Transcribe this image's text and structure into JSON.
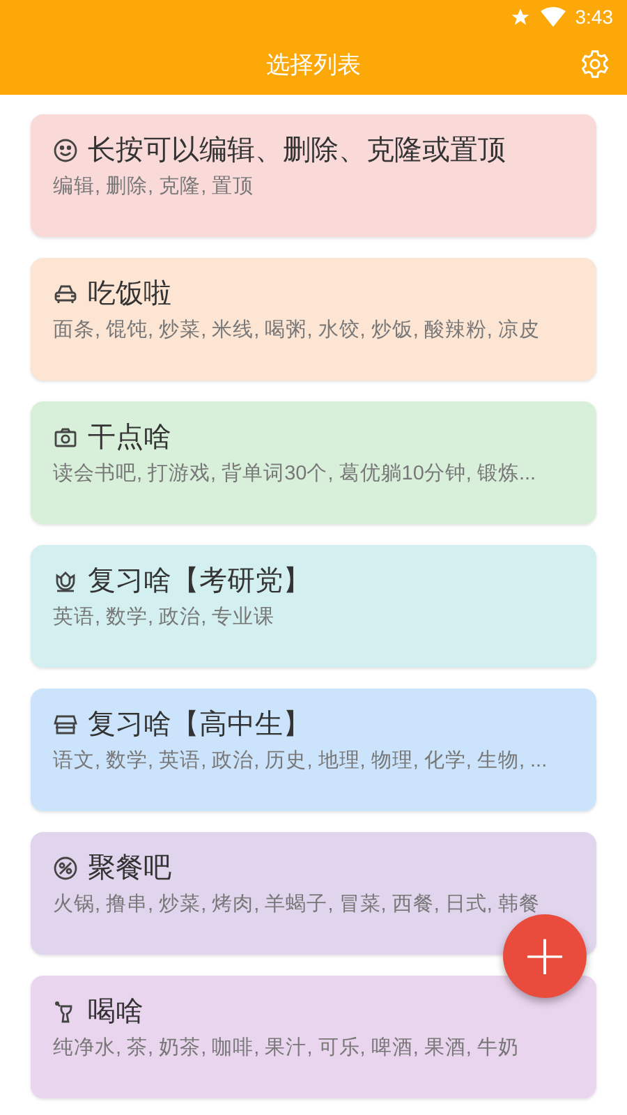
{
  "status_bar": {
    "time": "3:43"
  },
  "app_bar": {
    "title": "选择列表"
  },
  "lists": [
    {
      "kind": "smile",
      "title": "长按可以编辑、删除、克隆或置顶",
      "items": "编辑, 删除, 克隆, 置顶",
      "color": "#f9dad9"
    },
    {
      "kind": "car",
      "title": "吃饭啦",
      "items": "面条, 馄饨, 炒菜, 米线, 喝粥, 水饺, 炒饭, 酸辣粉, 凉皮",
      "color": "#fde5d4"
    },
    {
      "kind": "camera",
      "title": "干点啥",
      "items": "读会书吧, 打游戏, 背单词30个, 葛优躺10分钟, 锻炼...",
      "color": "#d8efda"
    },
    {
      "kind": "flower",
      "title": "复习啥【考研党】",
      "items": "英语, 数学, 政治, 专业课",
      "color": "#d3efef"
    },
    {
      "kind": "shop",
      "title": "复习啥【高中生】",
      "items": "语文, 数学, 英语, 政治, 历史, 地理, 物理, 化学, 生物, ...",
      "color": "#cce4fb"
    },
    {
      "kind": "plate",
      "title": "聚餐吧",
      "items": "火锅, 撸串, 炒菜, 烤肉, 羊蝎子, 冒菜, 西餐, 日式, 韩餐",
      "color": "#e1d5ee"
    },
    {
      "kind": "drink",
      "title": "喝啥",
      "items": "纯净水, 茶, 奶茶, 咖啡, 果汁, 可乐, 啤酒, 果酒, 牛奶",
      "color": "#ead5ef"
    }
  ],
  "fab": {
    "icon": "+"
  }
}
